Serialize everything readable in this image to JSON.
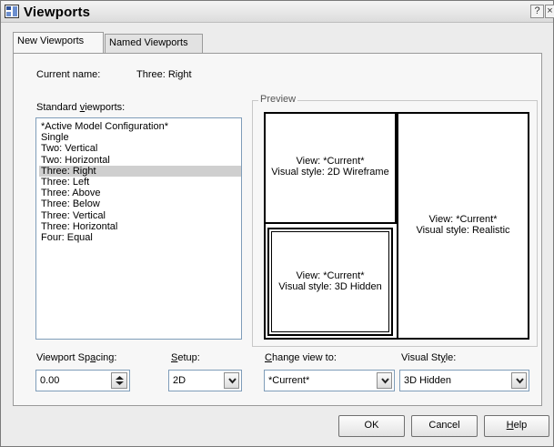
{
  "window": {
    "title": "Viewports"
  },
  "titlebar_buttons": {
    "help": "?",
    "close": "×"
  },
  "tabs": [
    {
      "label": "New Viewports"
    },
    {
      "label": "Named Viewports"
    }
  ],
  "current_name": {
    "label": "Current name:",
    "value": "Three: Right"
  },
  "standard_viewports": {
    "label_pre": "Standard ",
    "label_ul": "v",
    "label_post": "iewports:",
    "items": [
      "*Active Model Configuration*",
      "Single",
      "Two:  Vertical",
      "Two:  Horizontal",
      "Three: Right",
      "Three: Left",
      "Three: Above",
      "Three: Below",
      "Three: Vertical",
      "Three: Horizontal",
      "Four:  Equal"
    ],
    "selected": "Three: Right"
  },
  "preview": {
    "label": "Preview",
    "viewports": [
      {
        "view": "View: *Current*",
        "style": "Visual style: 2D Wireframe"
      },
      {
        "view": "View: *Current*",
        "style": "Visual style: 3D Hidden"
      },
      {
        "view": "View: *Current*",
        "style": "Visual style: Realistic"
      }
    ]
  },
  "viewport_spacing": {
    "label_pre": "Viewport Sp",
    "label_ul": "a",
    "label_post": "cing:",
    "value": "0.00"
  },
  "setup": {
    "label_pre": "",
    "label_ul": "S",
    "label_post": "etup:",
    "value": "2D"
  },
  "change_view": {
    "label_pre": "",
    "label_ul": "C",
    "label_post": "hange view to:",
    "value": "*Current*"
  },
  "visual_style": {
    "label_pre": "Visual St",
    "label_ul": "y",
    "label_post": "le:",
    "value": "3D Hidden"
  },
  "buttons": {
    "ok": "OK",
    "cancel": "Cancel",
    "help_ul": "H",
    "help_post": "elp"
  },
  "icons": {
    "window": "viewports-icon",
    "dropdown": "chevron-down-icon",
    "spin": "spinner-arrows-icon"
  }
}
